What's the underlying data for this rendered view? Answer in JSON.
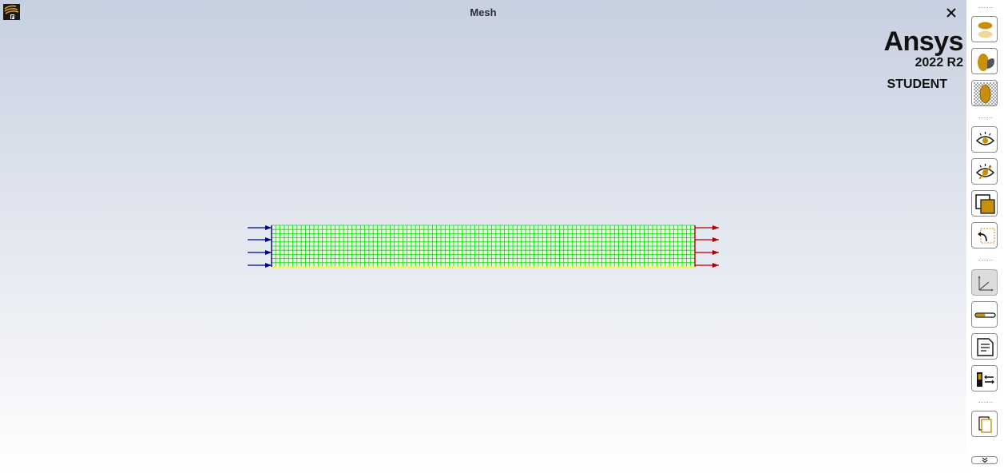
{
  "window": {
    "title": "Mesh",
    "close_symbol": "✕"
  },
  "app_icon": "fluent-app-icon",
  "brand": {
    "name": "Ansys",
    "version": "2022 R2",
    "edition": "STUDENT"
  },
  "mesh_view": {
    "inlet_arrow_color": "#00008b",
    "outlet_arrow_color": "#b00000",
    "mesh_line_color": "#00e000",
    "wall_line_color": "#ffff00"
  },
  "toolbar": {
    "buttons": [
      {
        "icon": "surface-display-icon"
      },
      {
        "icon": "cutaway-view-icon"
      },
      {
        "icon": "mesh-display-icon"
      },
      {
        "icon": "show-icon"
      },
      {
        "icon": "hide-icon"
      },
      {
        "icon": "fit-to-window-icon"
      },
      {
        "icon": "undo-view-icon"
      },
      {
        "icon": "axes-icon",
        "pressed": true
      },
      {
        "icon": "ruler-icon"
      },
      {
        "icon": "annotation-icon"
      },
      {
        "icon": "legend-icon"
      },
      {
        "icon": "copy-view-icon"
      },
      {
        "icon": "more-tools-icon"
      }
    ]
  }
}
